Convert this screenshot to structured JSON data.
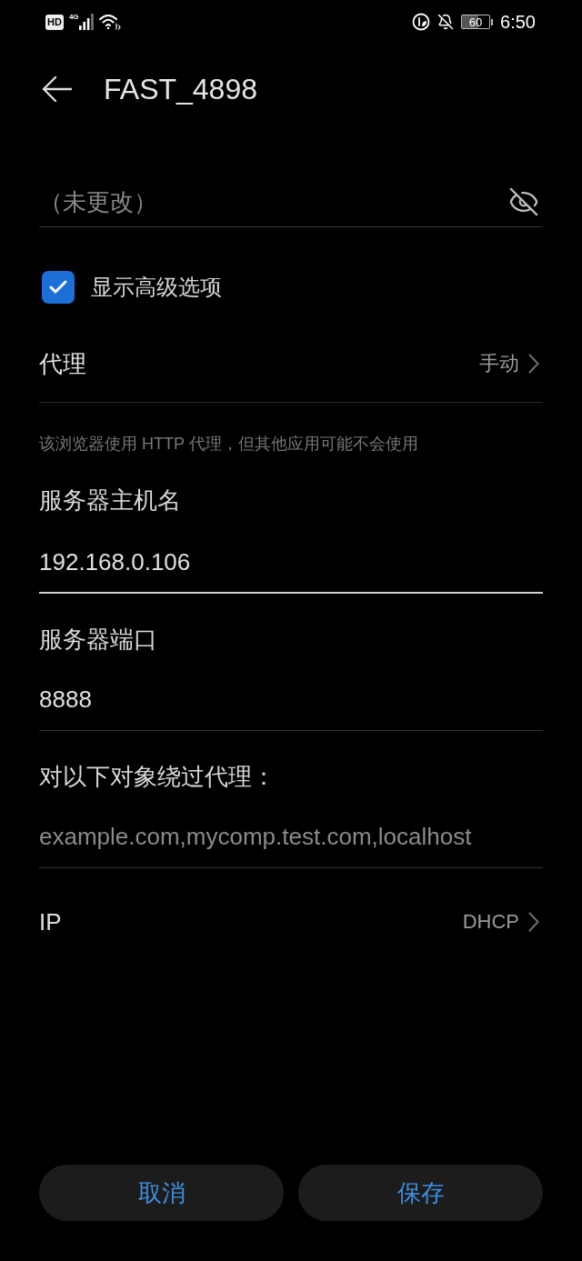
{
  "status_bar": {
    "hd_badge": "HD",
    "network_type": "4G",
    "battery_text": "60",
    "time": "6:50"
  },
  "header": {
    "title": "FAST_4898"
  },
  "password": {
    "placeholder": "（未更改）",
    "visible": false
  },
  "advanced_options": {
    "label": "显示高级选项",
    "checked": true
  },
  "proxy": {
    "label": "代理",
    "value": "手动"
  },
  "proxy_hint": "该浏览器使用 HTTP 代理，但其他应用可能不会使用",
  "fields": [
    {
      "label": "服务器主机名",
      "value": "192.168.0.106",
      "focused": true
    },
    {
      "label": "服务器端口",
      "value": "8888",
      "focused": false
    },
    {
      "label": "对以下对象绕过代理：",
      "placeholder": "example.com,mycomp.test.com,localhost",
      "focused": false
    }
  ],
  "ip": {
    "label": "IP",
    "value": "DHCP"
  },
  "buttons": [
    {
      "label": "取消"
    },
    {
      "label": "保存"
    }
  ]
}
